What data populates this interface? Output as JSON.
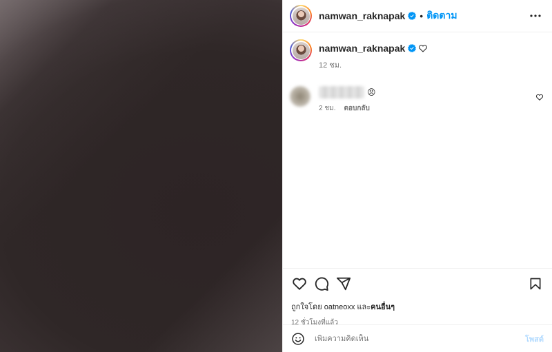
{
  "header": {
    "username": "namwan_raknapak",
    "separator": "•",
    "follow_label": "ติดตาม"
  },
  "caption": {
    "username": "namwan_raknapak",
    "time": "12 ชม."
  },
  "comment": {
    "emoji": "😣",
    "time": "2 ชม.",
    "reply_label": "ตอบกลับ"
  },
  "likes": {
    "prefix": "ถูกใจโดย",
    "user": "oatneoxx",
    "conjunction": "และ",
    "others": "คนอื่นๆ"
  },
  "post_time": "12 ชั่วโมงที่แล้ว",
  "add_comment": {
    "placeholder": "เพิ่มความคิดเห็น",
    "post_label": "โพสต์"
  },
  "icons": {
    "verified": "verified-badge-icon",
    "more": "more-horizontal-icon",
    "like": "heart-icon",
    "comment": "comment-icon",
    "share": "share-icon",
    "save": "bookmark-icon",
    "emoji": "emoji-smile-icon"
  },
  "colors": {
    "accent": "#0095f6",
    "verified": "#0095f6",
    "muted_text": "#737373",
    "post_disabled": "#b3dbff"
  }
}
